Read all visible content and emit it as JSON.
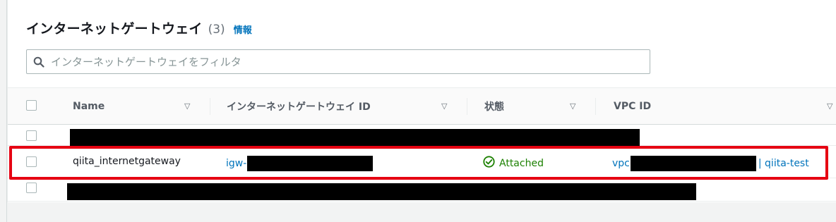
{
  "header": {
    "title": "インターネットゲートウェイ",
    "count": "(3)",
    "info_label": "情報"
  },
  "search": {
    "placeholder": "インターネットゲートウェイをフィルタ"
  },
  "table": {
    "columns": [
      {
        "label": "Name"
      },
      {
        "label": "インターネットゲートウェイ ID"
      },
      {
        "label": "状態"
      },
      {
        "label": "VPC ID"
      }
    ],
    "rows": [
      {
        "name": "",
        "igw_id": "",
        "state": "",
        "vpc": ""
      },
      {
        "name": "qiita_internetgateway",
        "igw_id": "igw-",
        "state": "Attached",
        "vpc_prefix": "vpc",
        "vpc_suffix": "| qiita-test"
      },
      {
        "name": "",
        "igw_id": "",
        "state": "",
        "vpc": ""
      }
    ]
  },
  "colors": {
    "link": "#0073bb",
    "status_ok": "#1d8102",
    "highlight": "#e60012"
  }
}
